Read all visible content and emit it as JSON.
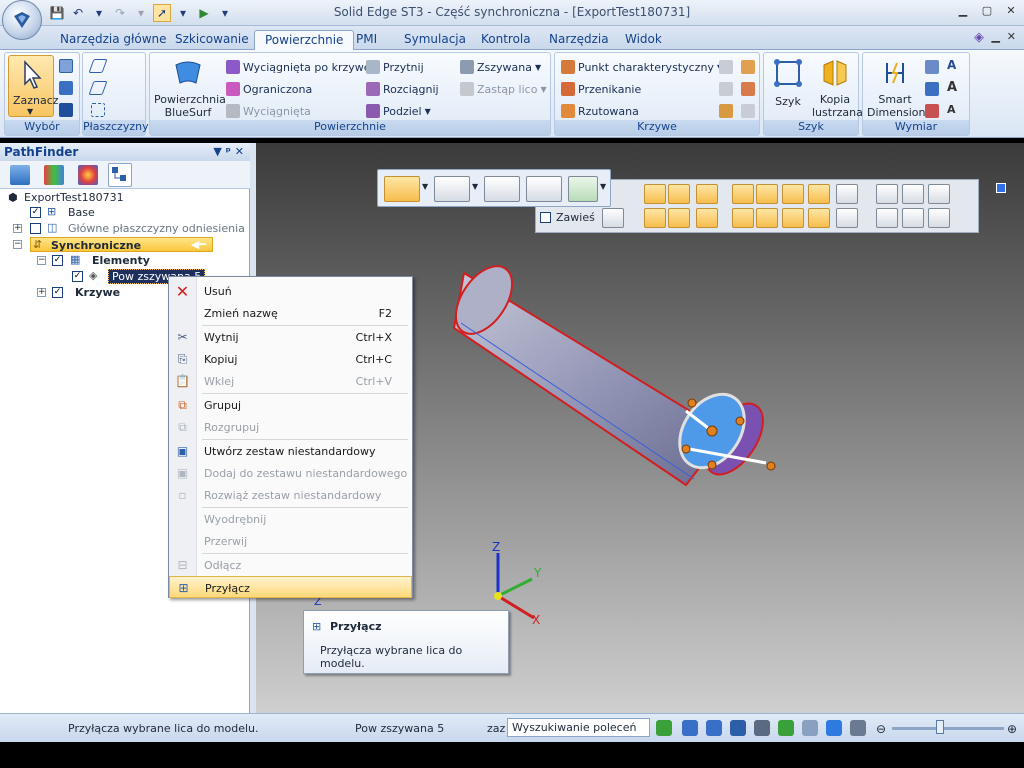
{
  "window": {
    "title": "Solid Edge ST3 - Część synchroniczna - [ExportTest180731]"
  },
  "tabs": [
    "Narzędzia główne",
    "Szkicowanie",
    "Powierzchnie",
    "PMI",
    "Symulacja",
    "Kontrola",
    "Narzędzia",
    "Widok"
  ],
  "active_tab": "Powierzchnie",
  "ribbon": {
    "wybor": {
      "label": "Wybór",
      "select": "Zaznacz"
    },
    "plaszczyzny": {
      "label": "Płaszczyzny"
    },
    "powierzchnie": {
      "label": "Powierzchnie",
      "bluesurf": "Powierzchnia BlueSurf",
      "wyciagnieta_po_krzywej": "Wyciągnięta po krzywej",
      "ograniczona": "Ograniczona",
      "wyciagnieta": "Wyciągnięta",
      "przytnij": "Przytnij",
      "rozciagnij": "Rozciągnij",
      "podziel": "Podziel",
      "zszywana": "Zszywana",
      "zastap_lico": "Zastąp lico"
    },
    "krzywe": {
      "label": "Krzywe",
      "punkt": "Punkt charakterystyczny",
      "przenikanie": "Przenikanie",
      "rzutowana": "Rzutowana"
    },
    "szyk": {
      "label": "Szyk",
      "szyk": "Szyk",
      "kopia_lustrzana": "Kopia lustrzana"
    },
    "wymiar": {
      "label": "Wymiar",
      "smart": "Smart Dimension"
    }
  },
  "pathfinder": {
    "title": "PathFinder",
    "controls": "▼ ᵖ ✕",
    "root": "ExportTest180731",
    "base": "Base",
    "planes": "Główne płaszczyzny odniesienia",
    "sync": "Synchroniczne",
    "elementy": "Elementy",
    "pow": "Pow zszywana 5",
    "krzywe": "Krzywe"
  },
  "context_menu": {
    "items": [
      {
        "label": "Usuń",
        "shortcut": ""
      },
      {
        "label": "Zmień nazwę",
        "shortcut": "F2"
      },
      {
        "label": "Wytnij",
        "shortcut": "Ctrl+X"
      },
      {
        "label": "Kopiuj",
        "shortcut": "Ctrl+C"
      },
      {
        "label": "Wklej",
        "shortcut": "Ctrl+V"
      },
      {
        "label": "Grupuj",
        "shortcut": ""
      },
      {
        "label": "Rozgrupuj",
        "shortcut": ""
      },
      {
        "label": "Utwórz zestaw niestandardowy",
        "shortcut": ""
      },
      {
        "label": "Dodaj do zestawu niestandardowego",
        "shortcut": ""
      },
      {
        "label": "Rozwiąż zestaw niestandardowy",
        "shortcut": ""
      },
      {
        "label": "Wyodrębnij",
        "shortcut": ""
      },
      {
        "label": "Przerwij",
        "shortcut": ""
      },
      {
        "label": "Odłącz",
        "shortcut": ""
      },
      {
        "label": "Przyłącz",
        "shortcut": ""
      }
    ]
  },
  "tooltip": {
    "title": "Przyłącz",
    "text": "Przyłącza wybrane lica do modelu."
  },
  "viewport": {
    "zawies": "Zawieś",
    "axis_x": "X",
    "axis_y": "Y",
    "axis_z": "Z",
    "axis_z2": "Z"
  },
  "status": {
    "message": "Przyłącza wybrane lica do modelu.",
    "selection": "Pow zszywana 5",
    "zaz": "zaz",
    "search": "Wyszukiwanie poleceń"
  }
}
